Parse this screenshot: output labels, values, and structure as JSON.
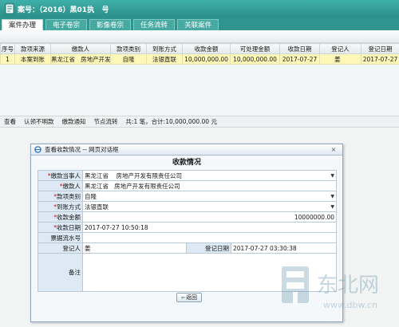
{
  "title": "案号：（2016）黑01执   号",
  "tabs": [
    {
      "label": "案件办理",
      "active": true
    },
    {
      "label": "电子卷宗",
      "active": false
    },
    {
      "label": "影像卷宗",
      "active": false
    },
    {
      "label": "任务流转",
      "active": false
    },
    {
      "label": "关联案件",
      "active": false
    }
  ],
  "grid": {
    "headers": [
      "序号",
      "款项来源",
      "缴款人",
      "款项类别",
      "到账方式",
      "收款金额",
      "可处理金额",
      "收款日期",
      "登记人",
      "登记日期"
    ],
    "rows": [
      [
        "1",
        "本案到账",
        "黑龙江省   房地产开发有",
        "自隆",
        "法银直联",
        "10,000,000.00",
        "10,000,000.00",
        "2017-07-27",
        "姜   ",
        "2017-07-27"
      ]
    ]
  },
  "bottombar": {
    "buttons": [
      "查看",
      "认领不明款",
      "缴款通知",
      "节点流转"
    ],
    "summary": "共:1 笔，合计:10,000,000.00 元"
  },
  "dialog": {
    "title": "查看收款情况 -- 网页对话框",
    "close": "×",
    "heading": "收款情况",
    "fields": {
      "payer_party_label": "缴款当事人",
      "payer_party": "黑龙江省    房地产开发有限责任公司",
      "payer_label": "缴款人",
      "payer": "黑龙江省   房地产开发有限责任公司",
      "category_label": "款项类别",
      "category": "自隆",
      "method_label": "到账方式",
      "method": "法银直联",
      "amount_label": "收款金额",
      "amount": "10000000.00",
      "date_label": "收款日期",
      "date": "2017-07-27 10:50:18",
      "receipt_label": "票据流水号",
      "receipt": "",
      "registrar_label": "登记人",
      "registrar": "姜   ",
      "reg_date_label": "登记日期",
      "reg_date": "2017-07-27 03:30:38",
      "memo_label": "备注",
      "memo": ""
    },
    "return_label": "返回"
  },
  "watermark": {
    "text": "东北网",
    "url_text": "www.dbw.cn"
  },
  "colors": {
    "header": "#2e948d",
    "selected_row": "#fff7b8",
    "label_bg": "#dde9f4"
  }
}
